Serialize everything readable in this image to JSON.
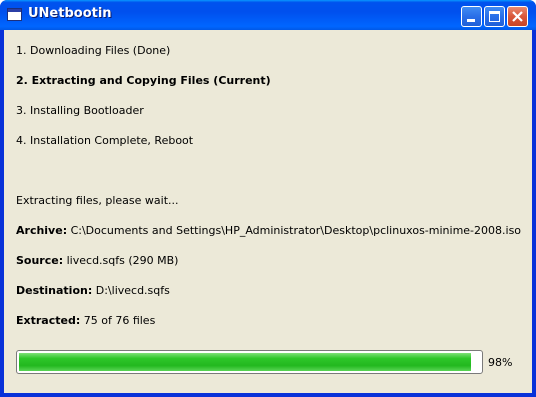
{
  "window": {
    "title": "UNetbootin"
  },
  "steps": [
    {
      "label": "1. Downloading Files (Done)",
      "current": false
    },
    {
      "label": "2. Extracting and Copying Files (Current)",
      "current": true
    },
    {
      "label": "3. Installing Bootloader",
      "current": false
    },
    {
      "label": "4. Installation Complete, Reboot",
      "current": false
    }
  ],
  "status": {
    "message": "Extracting files, please wait...",
    "archive_label": "Archive:",
    "archive_value": "C:\\Documents and Settings\\HP_Administrator\\Desktop\\pclinuxos-minime-2008.iso",
    "source_label": "Source:",
    "source_value": "livecd.sqfs (290 MB)",
    "destination_label": "Destination:",
    "destination_value": "D:\\livecd.sqfs",
    "extracted_label": "Extracted:",
    "extracted_value": "75 of 76 files"
  },
  "progress": {
    "percent": 98,
    "label": "98%"
  },
  "colors": {
    "progress_fill": "#22b81f",
    "titlebar": "#0053ee",
    "client_background": "#ece9d8"
  }
}
